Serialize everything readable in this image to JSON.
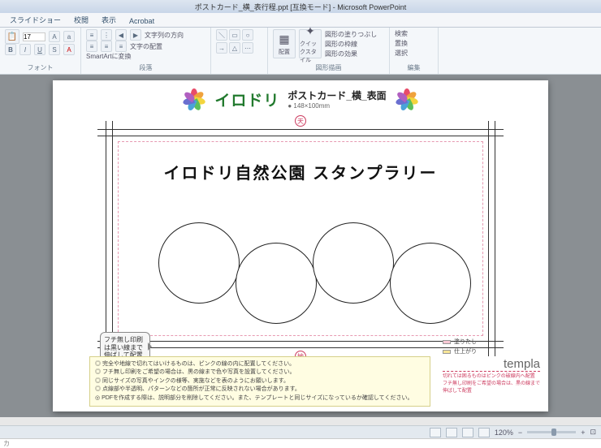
{
  "window": {
    "title": "ポストカード_横_表行程.ppt [互換モード] - Microsoft PowerPoint"
  },
  "tabs": [
    "スライドショー",
    "校閲",
    "表示",
    "Acrobat"
  ],
  "ribbon": {
    "font": {
      "size": "17",
      "group_label": "フォント"
    },
    "paragraph": {
      "dir_label": "文字列の方向",
      "align_label": "文字の配置",
      "smartart_label": "SmartArtに変換",
      "group_label": "段落"
    },
    "drawing": {
      "arrange_label": "配置",
      "quick_label": "クイックスタイル",
      "fill_label": "図形の塗りつぶし",
      "outline_label": "図形の枠線",
      "effects_label": "図形の効果",
      "group_label": "図形描画"
    },
    "editing": {
      "find_label": "検索",
      "replace_label": "置換",
      "select_label": "選択",
      "group_label": "編集"
    }
  },
  "slide": {
    "brand": "イロドリ",
    "subtitle": "ポストカード_横_表面",
    "dimensions": "● 148×100mm",
    "marker_top": "天",
    "marker_bottom": "地",
    "title": "イロドリ自然公園 スタンプラリー",
    "callout": "フチ無し印刷は黒い線まで伸ばして配置してください。",
    "notes": [
      "完全や地線で切れてはいけるものは、ピンクの線の内に配置してください。",
      "フチ無し印刷をご希望の場合は、黒の線まで色や写真を設置してください。",
      "同じサイズの写真やインクの様等、実施などを表のようにお願いします。",
      "点線部や半透明、パターンなどの箇所が正常に反映されない場合があります。",
      "PDFを作成する際は、説明部分を削除してください。また、テンプレートと同じサイズになっているか確認してください。"
    ],
    "legend": {
      "nuritashi": "塗りたし",
      "shiagari": "仕上がり",
      "templa_label": "templa",
      "note1": "切れては困るものはピンクの破線内へ配置",
      "note2": "フチ無し印刷をご希望の場合は、黒の線まで伸ばして配置"
    }
  },
  "status": {
    "zoom": "120%",
    "ime": "カ"
  }
}
